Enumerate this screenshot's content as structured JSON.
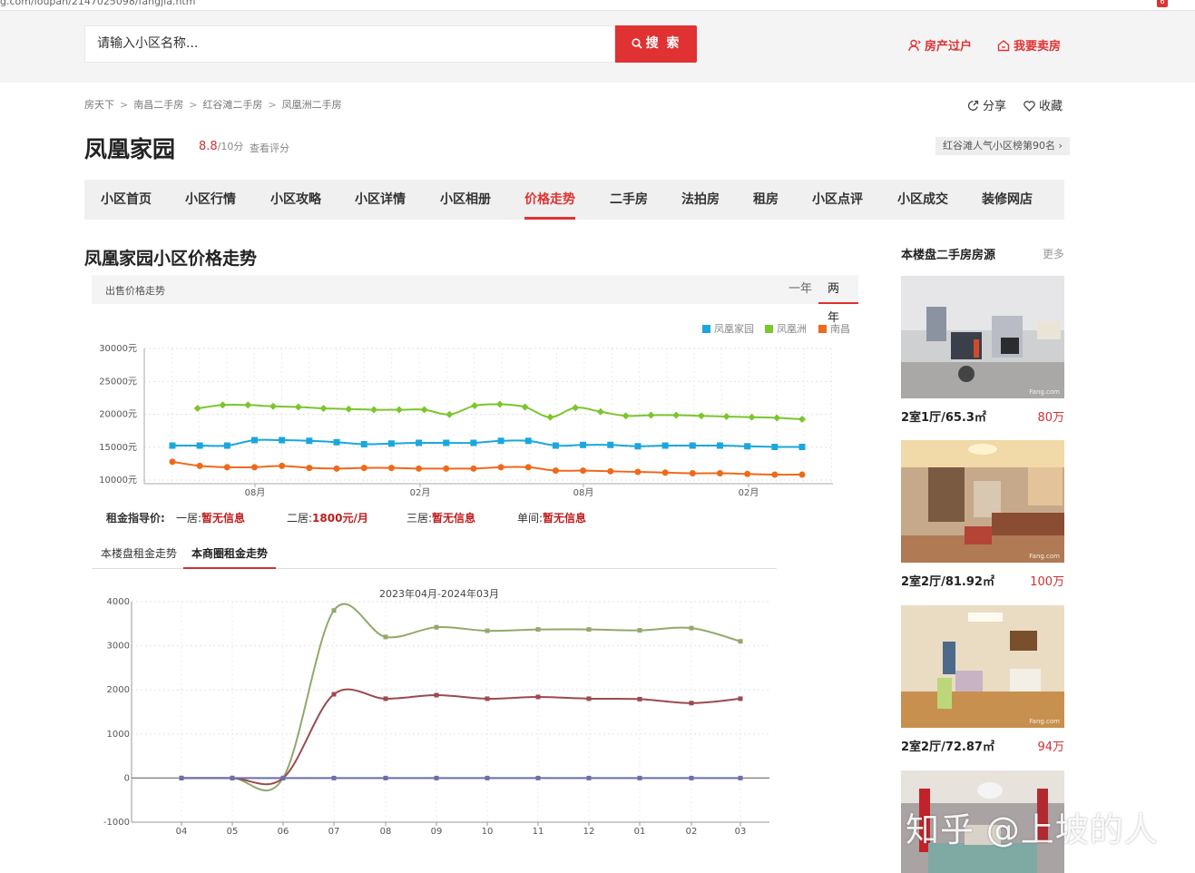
{
  "browser": {
    "url": "g.com/loupan/2147025098/fangjia.htm"
  },
  "header": {
    "search_placeholder": "请输入小区名称...",
    "search_button": "搜 索",
    "transfer_label": "房产过户",
    "sell_label": "我要卖房"
  },
  "breadcrumb": [
    "房天下",
    "南昌二手房",
    "红谷滩二手房",
    "凤凰洲二手房"
  ],
  "actions": {
    "share": "分享",
    "favorite": "收藏"
  },
  "estate": {
    "name": "凤凰家园",
    "score": "8.8",
    "score_max": "/10分",
    "view_score": "查看评分",
    "rank": "红谷滩人气小区榜第90名"
  },
  "nav": [
    {
      "label": "小区首页"
    },
    {
      "label": "小区行情"
    },
    {
      "label": "小区攻略"
    },
    {
      "label": "小区详情"
    },
    {
      "label": "小区相册"
    },
    {
      "label": "价格走势",
      "active": true
    },
    {
      "label": "二手房"
    },
    {
      "label": "法拍房"
    },
    {
      "label": "租房"
    },
    {
      "label": "小区点评"
    },
    {
      "label": "小区成交"
    },
    {
      "label": "装修网店"
    }
  ],
  "section": {
    "title": "凤凰家园小区价格走势",
    "sale_label": "出售价格走势",
    "range_tabs": [
      {
        "label": "一年"
      },
      {
        "label": "两年",
        "active": true
      }
    ]
  },
  "rent_guide": {
    "heading": "租金指导价:",
    "items": [
      {
        "label": "一居:",
        "value": "暂无信息"
      },
      {
        "label": "二居:",
        "value": "1800元/月"
      },
      {
        "label": "三居:",
        "value": "暂无信息"
      },
      {
        "label": "单间:",
        "value": "暂无信息"
      }
    ]
  },
  "rent_tabs": [
    {
      "label": "本楼盘租金走势"
    },
    {
      "label": "本商圈租金走势",
      "active": true
    }
  ],
  "colors": {
    "accent": "#e03232",
    "series_blue": "#1aa7dd",
    "series_green": "#7bc62c",
    "series_orange": "#ee6a1a",
    "rent_green": "#93a86a",
    "rent_red": "#9b4a50",
    "rent_blue": "#6a6fa8"
  },
  "chart_data": [
    {
      "type": "line",
      "title": "",
      "ylim": [
        10000,
        30000
      ],
      "yticks": [
        "30000元",
        "25000元",
        "20000元",
        "15000元",
        "10000元"
      ],
      "xtick_labels": [
        "08月",
        "02月",
        "08月",
        "02月"
      ],
      "legend": "top-right",
      "series": [
        {
          "name": "凤凰家园",
          "color": "#1aa7dd",
          "marker": "square",
          "values": [
            15100,
            15100,
            15100,
            15900,
            15900,
            15800,
            15600,
            15300,
            15400,
            15500,
            15500,
            15500,
            15800,
            15800,
            15100,
            15200,
            15200,
            15000,
            15100,
            15100,
            15100,
            15000,
            14900,
            14900
          ]
        },
        {
          "name": "凤凰洲",
          "color": "#7bc62c",
          "marker": "diamond",
          "values": [
            null,
            20600,
            21100,
            21100,
            20900,
            20800,
            20600,
            20500,
            20400,
            20400,
            20400,
            19700,
            21000,
            21200,
            20800,
            19300,
            20700,
            20100,
            19500,
            19600,
            19600,
            19500,
            19400,
            19300,
            19200,
            19000
          ]
        },
        {
          "name": "南昌",
          "color": "#ee6a1a",
          "marker": "circle",
          "values": [
            12700,
            12100,
            11900,
            11900,
            12100,
            11800,
            11700,
            11800,
            11800,
            11700,
            11700,
            11700,
            11900,
            11900,
            11400,
            11400,
            11300,
            11200,
            11100,
            11000,
            11000,
            10900,
            10800,
            10800
          ]
        }
      ]
    },
    {
      "type": "line",
      "title": "2023年04月-2024年03月",
      "ylim": [
        -1000,
        4000
      ],
      "yticks": [
        "4000",
        "3000",
        "2000",
        "1000",
        "0",
        "-1000"
      ],
      "categories": [
        "04",
        "05",
        "06",
        "07",
        "08",
        "09",
        "10",
        "11",
        "12",
        "01",
        "02",
        "03"
      ],
      "series": [
        {
          "color": "#93a86a",
          "values": [
            0,
            0,
            0,
            3800,
            3200,
            3420,
            3340,
            3370,
            3370,
            3350,
            3400,
            3100
          ]
        },
        {
          "color": "#9b4a50",
          "values": [
            0,
            0,
            0,
            1900,
            1800,
            1880,
            1800,
            1840,
            1800,
            1790,
            1700,
            1800
          ]
        },
        {
          "color": "#6a6fa8",
          "values": [
            0,
            0,
            0,
            0,
            0,
            0,
            0,
            0,
            0,
            0,
            0,
            0
          ]
        }
      ]
    }
  ],
  "sidebar": {
    "title": "本楼盘二手房房源",
    "more": "更多",
    "photo_watermark": "Fang.com",
    "listings": [
      {
        "desc": "2室1厅/65.3㎡",
        "price": "80万"
      },
      {
        "desc": "2室2厅/81.92㎡",
        "price": "100万"
      },
      {
        "desc": "2室2厅/72.87㎡",
        "price": "94万"
      },
      {
        "desc": "",
        "price": ""
      }
    ]
  },
  "watermark": "知乎 @上坡的人"
}
